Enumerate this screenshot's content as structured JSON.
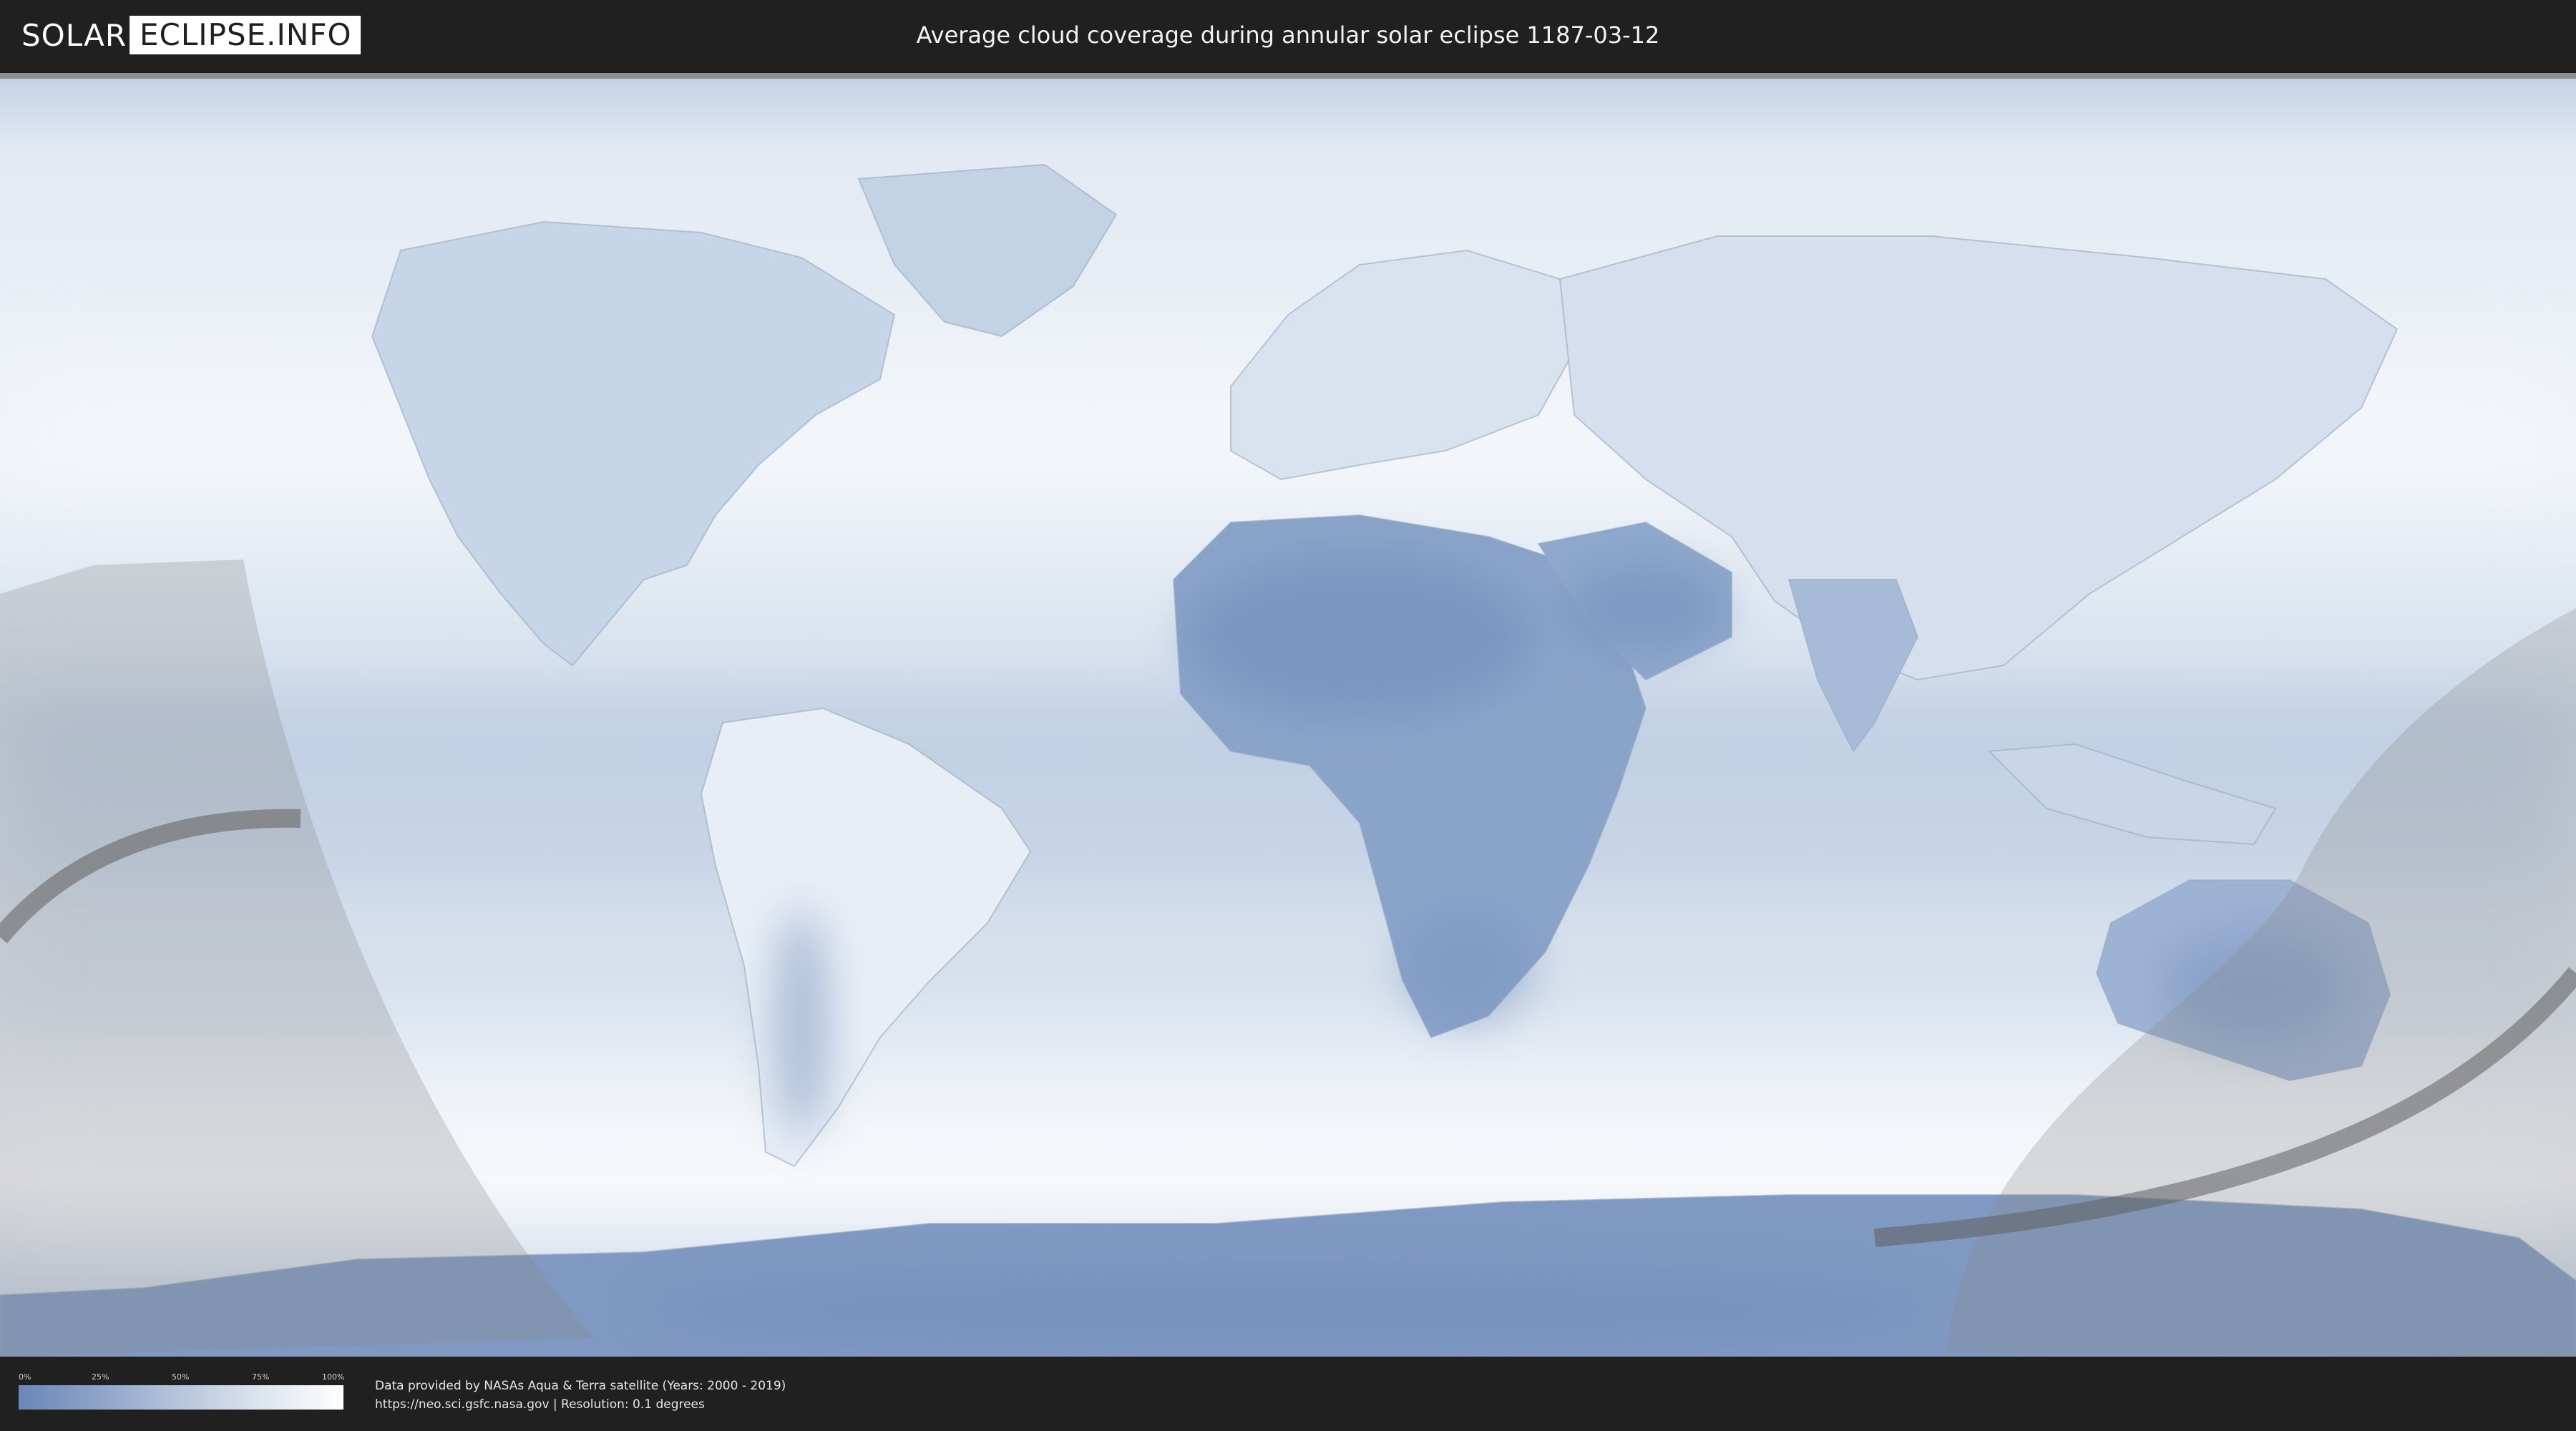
{
  "header": {
    "logo_part1": "SOLAR",
    "logo_part2": "ECLIPSE.INFO",
    "title": "Average cloud coverage during annular solar eclipse 1187-03-12"
  },
  "legend": {
    "ticks": [
      "0%",
      "25%",
      "50%",
      "75%",
      "100%"
    ],
    "tick_values": [
      0,
      25,
      50,
      75,
      100
    ],
    "color_low": "#6b87b8",
    "color_high": "#ffffff"
  },
  "footer": {
    "credit_line1": "Data provided by NASAs Aqua & Terra satellite (Years: 2000 - 2019)",
    "credit_line2": "https://neo.sci.gsfc.nasa.gov | Resolution: 0.1 degrees"
  },
  "colors": {
    "background": "#1f1f1f",
    "ocean_cloud": "#d6e0ec",
    "clear_sky": "#6f8cbc",
    "eclipse_shadow": "#888888",
    "eclipse_path": "#666666"
  }
}
